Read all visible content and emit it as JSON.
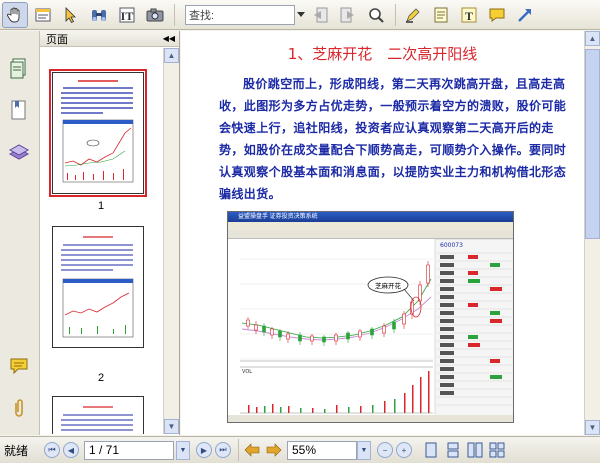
{
  "toolbar": {
    "search_placeholder": "查找:",
    "icons": [
      "hand-icon",
      "select-text-icon",
      "arrow-select-icon",
      "binoculars-icon",
      "text-select-icon",
      "camera-icon",
      "prev-result-icon",
      "next-result-icon",
      "search-options-icon",
      "highlight-icon",
      "note-pad-icon",
      "text-box-icon",
      "comment-icon",
      "arrow-tool-icon"
    ]
  },
  "sidebar": {
    "panel_title": "页面",
    "collapse_label": "◀◀",
    "tabs": [
      "pages-icon",
      "bookmarks-icon",
      "layers-icon",
      "comments-icon",
      "attachments-icon"
    ],
    "thumbnails": [
      {
        "number": "1",
        "selected": true
      },
      {
        "number": "2",
        "selected": false
      },
      {
        "number": "",
        "selected": false
      }
    ]
  },
  "document": {
    "title": "1、芝麻开花　二次高开阳线",
    "paragraph": "股价跳空而上，形成阳线，第二天再次跳高开盘，且高走高收，此图形为多方占优走势，一般预示着空方的溃败，股价可能会快速上行，追社阳线，投资者应认真观察第二天高开后的走势，如股价在成交量配合下顺势高走，可顺势介入操作。要同时认真观察个股基本面和消息面，以提防实业主力和机构借北形态骗线出货。",
    "screenshot": {
      "window_title": "益盟操盘手 证券投资决策系统",
      "callout_label": "芝麻开花",
      "stock_code": "600073",
      "volume_label": "VOL"
    }
  },
  "statusbar": {
    "status": "就绪",
    "page_display": "1 / 71",
    "zoom": "55%"
  },
  "colors": {
    "title_red": "#d8262c",
    "body_blue": "#1c2aa6",
    "selection_red": "#d8262c"
  }
}
